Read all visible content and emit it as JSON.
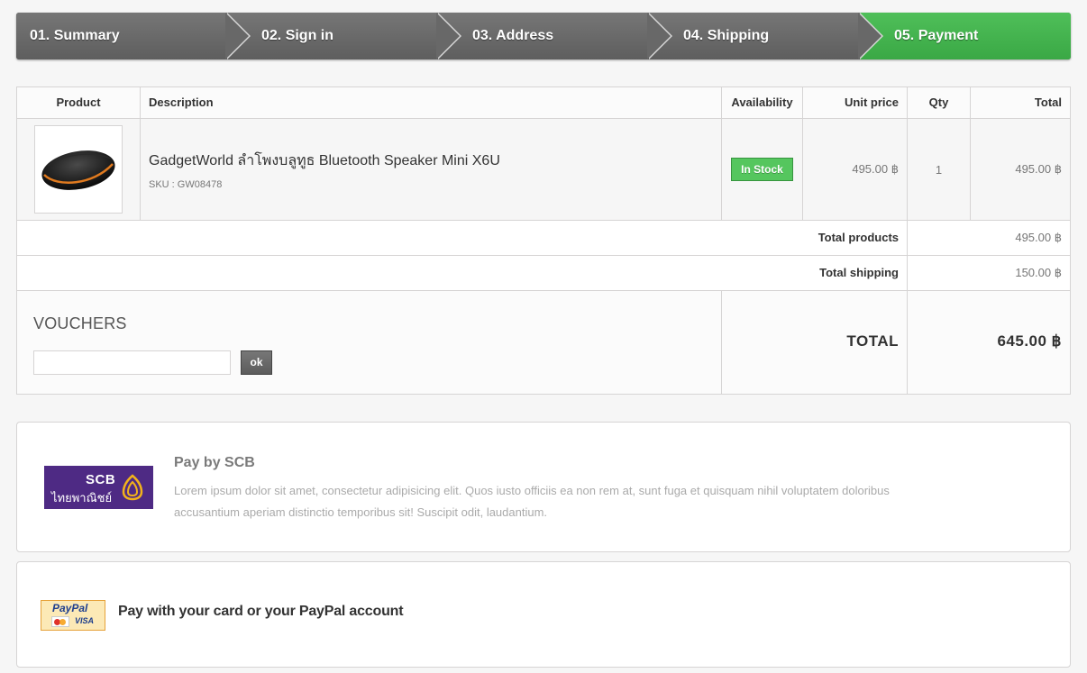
{
  "steps": [
    {
      "label": "01. Summary"
    },
    {
      "label": "02. Sign in"
    },
    {
      "label": "03. Address"
    },
    {
      "label": "04. Shipping"
    },
    {
      "label": "05. Payment",
      "active": true
    }
  ],
  "cart": {
    "headers": {
      "product": "Product",
      "description": "Description",
      "availability": "Availability",
      "unit_price": "Unit price",
      "qty": "Qty",
      "total": "Total"
    },
    "item": {
      "name": "GadgetWorld ลำโพงบลูทูธ Bluetooth Speaker Mini X6U",
      "sku": "SKU : GW08478",
      "availability": "In Stock",
      "unit_price": "495.00 ฿",
      "qty": "1",
      "total": "495.00 ฿",
      "image_icon": "speaker-product-image"
    },
    "total_products_label": "Total products",
    "total_products_value": "495.00 ฿",
    "total_shipping_label": "Total shipping",
    "total_shipping_value": "150.00 ฿",
    "vouchers_title": "VOUCHERS",
    "voucher_input_value": "",
    "voucher_button": "ok",
    "total_label": "TOTAL",
    "total_value": "645.00 ฿"
  },
  "payments": {
    "scb": {
      "logo_line1": "SCB",
      "logo_line2": "ไทยพาณิชย์",
      "title": "Pay by SCB",
      "text": "Lorem ipsum dolor sit amet, consectetur adipisicing elit. Quos iusto officiis ea non rem at, sunt fuga et quisquam nihil voluptatem doloribus accusantium aperiam distinctio temporibus sit! Suscipit odit, laudantium."
    },
    "paypal": {
      "logo_text": "PayPal",
      "logo_visa": "VISA",
      "title": "Pay with your card or your PayPal account"
    }
  },
  "colors": {
    "active_step": "#3aa845",
    "step": "#6a6a6a",
    "in_stock": "#55c65e",
    "scb_purple": "#4e2a84"
  }
}
